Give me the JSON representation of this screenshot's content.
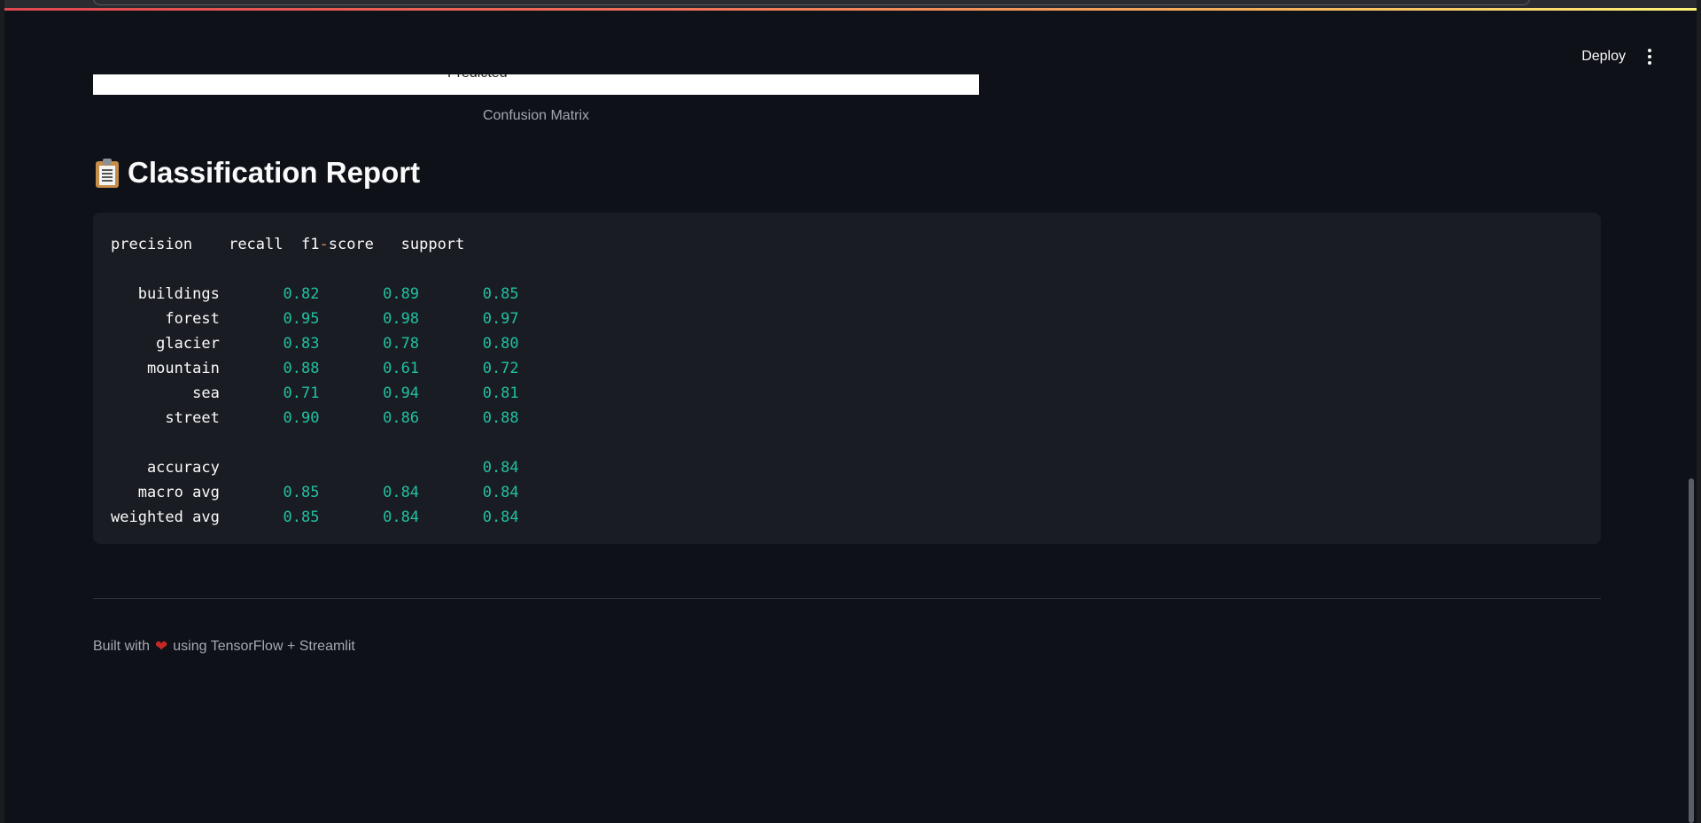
{
  "header": {
    "deploy_label": "Deploy"
  },
  "image": {
    "cut_text": "Predicted",
    "caption": "Confusion Matrix"
  },
  "report": {
    "title": "Classification Report",
    "icon": "clipboard-icon",
    "columns": [
      "precision",
      "recall",
      "f1-score",
      "support"
    ],
    "rows": [
      {
        "label": "buildings",
        "precision": "0.82",
        "recall": "0.89",
        "f1": "0.85"
      },
      {
        "label": "forest",
        "precision": "0.95",
        "recall": "0.98",
        "f1": "0.97"
      },
      {
        "label": "glacier",
        "precision": "0.83",
        "recall": "0.78",
        "f1": "0.80"
      },
      {
        "label": "mountain",
        "precision": "0.88",
        "recall": "0.61",
        "f1": "0.72"
      },
      {
        "label": "sea",
        "precision": "0.71",
        "recall": "0.94",
        "f1": "0.81"
      },
      {
        "label": "street",
        "precision": "0.90",
        "recall": "0.86",
        "f1": "0.88"
      }
    ],
    "summary": [
      {
        "label": "accuracy",
        "precision": "",
        "recall": "",
        "f1": "0.84"
      },
      {
        "label": "macro avg",
        "precision": "0.85",
        "recall": "0.84",
        "f1": "0.84"
      },
      {
        "label": "weighted avg",
        "precision": "0.85",
        "recall": "0.84",
        "f1": "0.84"
      }
    ]
  },
  "footer": {
    "prefix": "Built with",
    "heart": "❤",
    "suffix": "using TensorFlow + Streamlit"
  },
  "colors": {
    "background": "#0e1117",
    "code_background": "#1a1c23",
    "number_color": "#21c0a0",
    "heart_color": "#c62828"
  }
}
